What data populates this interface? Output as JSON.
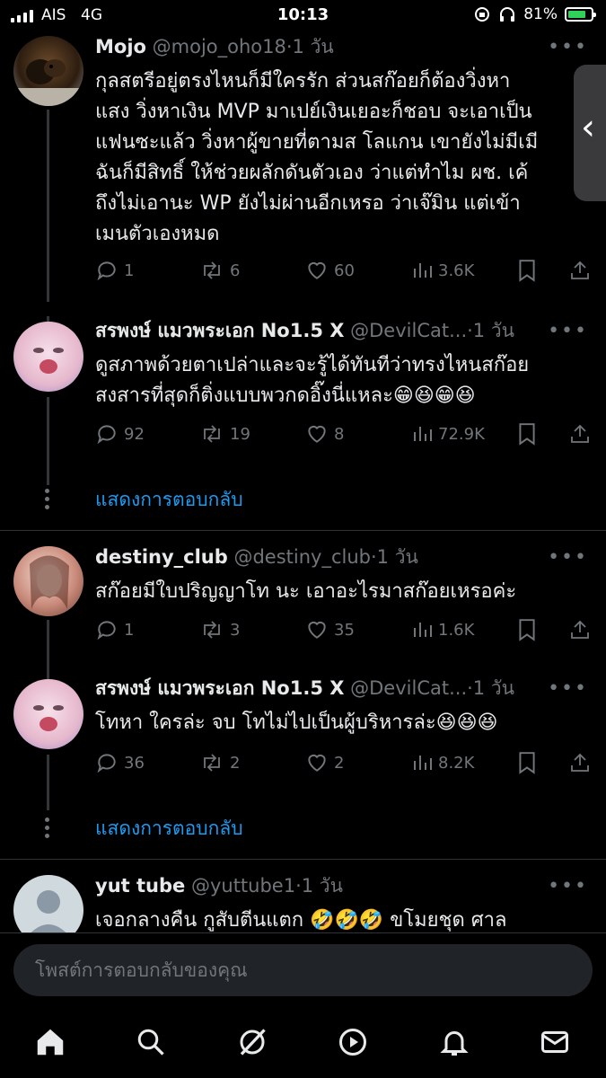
{
  "status_bar": {
    "carrier": "AIS",
    "network": "4G",
    "time": "10:13",
    "battery_percent": "81%",
    "battery_level": 0.81,
    "accent_color": "#30d158"
  },
  "tweets": [
    {
      "name": "Mojo",
      "handle": "@mojo_oho18",
      "time": "·1 วัน",
      "lines": [
        "กุลสตรีอยู่ตรงไหนก็มีใครรัก ส่วนสก๊อยก็ต้องวิ่งหา",
        "แสง วิ่งหาเงิน MVP มาเปย์เงินเยอะก็ชอบ จะเอาเป็น",
        "แฟนซะแล้ว  วิ่งหาผู้ขายที่ตามส โลแกน เขายังไม่มีเมี",
        "ฉันก็มีสิทธิ์ ให้ช่วยผลักดันตัวเอง ว่าแต่ทำไม ผช. เค้",
        "ถึงไม่เอานะ   WP ยังไม่ผ่านอีกเหรอ ว่าเจ๊มิน แต่เข้า",
        "เมนตัวเองหมด"
      ],
      "replies": "1",
      "retweets": "6",
      "likes": "60",
      "views": "3.6K"
    },
    {
      "name": "สรพงษ์ แมวพระเอก No1.5 X",
      "handle": "@DevilCat...",
      "time": "·1 วัน",
      "lines": [
        "ดูสภาพด้วยตาเปล่าและจะรู้ได้ทันทีว่าทรงไหนสก๊อย",
        "สงสารที่สุดก็ติ่งแบบพวกดอิ๊งนี่แหละ😁😆😁😆"
      ],
      "replies": "92",
      "retweets": "19",
      "likes": "8",
      "views": "72.9K"
    },
    {
      "name": "destiny_club",
      "handle": "@destiny_club",
      "time": "·1 วัน",
      "lines": [
        "สก๊อยมีใบปริญญาโท นะ  เอาอะไรมาสก๊อยเหรอค่ะ"
      ],
      "replies": "1",
      "retweets": "3",
      "likes": "35",
      "views": "1.6K"
    },
    {
      "name": "สรพงษ์ แมวพระเอก No1.5 X",
      "handle": "@DevilCat...",
      "time": "·1 วัน",
      "lines": [
        "โทหา ใครล่ะ จบ โทไม่ไปเป็นผู้บริหารล่ะ😆😆😆"
      ],
      "replies": "36",
      "retweets": "2",
      "likes": "2",
      "views": "8.2K"
    },
    {
      "name": "yut tube",
      "handle": "@yuttube1",
      "time": "·1 วัน",
      "lines": [
        "เจอกลางคืน กูสับตีนแตก  🤣🤣🤣   ขโมยชุด ศาล"
      ]
    }
  ],
  "show_replies_label": "แสดงการตอบกลับ",
  "reply_placeholder": "โพสต์การตอบกลับของคุณ",
  "tabs": [
    "home-icon",
    "search-icon",
    "grok-icon",
    "video-icon",
    "notifications-icon",
    "messages-icon"
  ],
  "colors": {
    "link": "#1d9bf0",
    "muted": "#71767b",
    "background": "#000000"
  }
}
